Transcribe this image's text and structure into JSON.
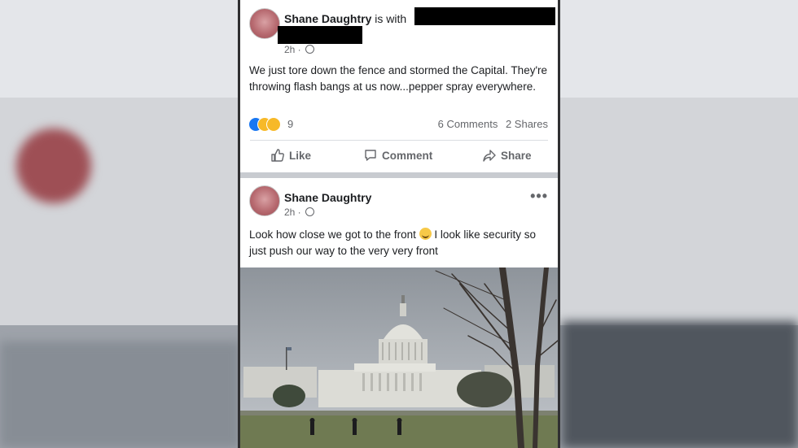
{
  "post1": {
    "author": "Shane Daughtry",
    "with_label": "is with",
    "time": "2h ·",
    "text": "We just tore down the fence and stormed the Capital. They're throwing flash bangs at us now...pepper spray everywhere.",
    "reaction_count": "9",
    "comments": "6 Comments",
    "shares": "2 Shares",
    "actions": {
      "like": "Like",
      "comment": "Comment",
      "share": "Share"
    }
  },
  "post2": {
    "author": "Shane Daughtry",
    "time": "2h ·",
    "more": "•••",
    "text_before_emoji": "Look how close we got to the front",
    "text_after_emoji": "I look like security so just push our way to the very very front",
    "photo_subject": "US Capitol building"
  },
  "colors": {
    "brand_blue": "#1877f2",
    "meta_gray": "#65676b",
    "text": "#1c1e21",
    "reaction_yellow": "#f7b928"
  },
  "icons": [
    "globe-icon",
    "like-icon",
    "comment-icon",
    "share-icon",
    "like-reaction-icon",
    "wow-reaction-icon",
    "haha-reaction-icon",
    "grinning-emoji-icon",
    "more-options-icon"
  ]
}
